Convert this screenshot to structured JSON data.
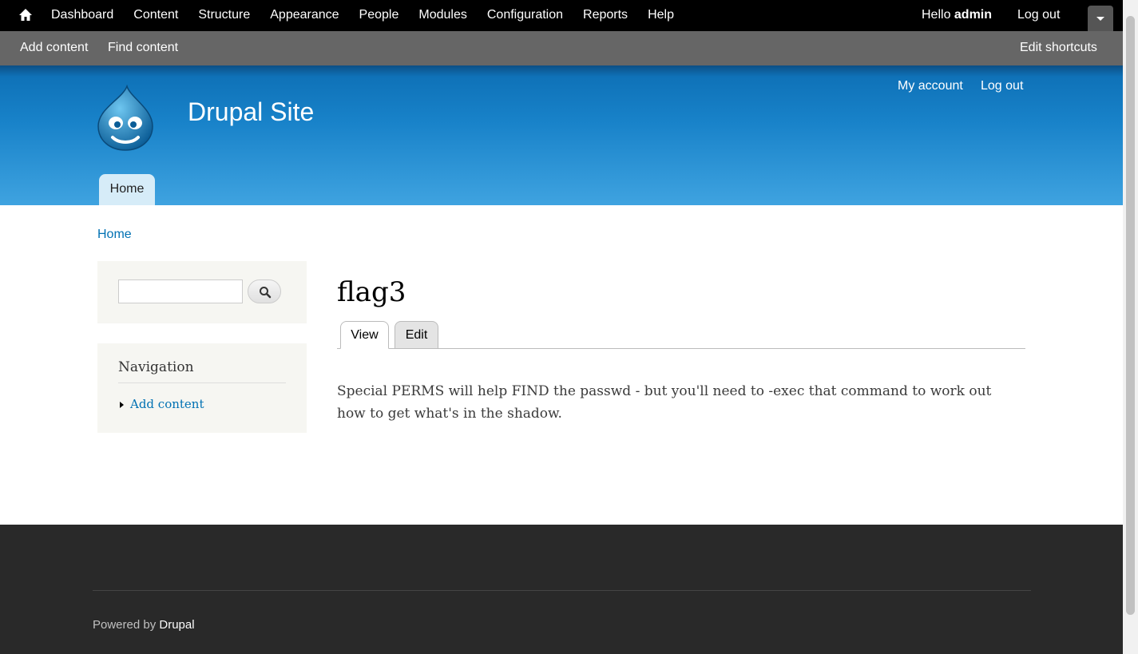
{
  "toolbar": {
    "menu": [
      "Dashboard",
      "Content",
      "Structure",
      "Appearance",
      "People",
      "Modules",
      "Configuration",
      "Reports",
      "Help"
    ],
    "hello_prefix": "Hello ",
    "user": "admin",
    "logout": "Log out"
  },
  "shortcuts": {
    "add_content": "Add content",
    "find_content": "Find content",
    "edit_shortcuts": "Edit shortcuts"
  },
  "header": {
    "site_name": "Drupal Site",
    "my_account": "My account",
    "logout": "Log out",
    "home_tab": "Home"
  },
  "breadcrumb": "Home",
  "search": {
    "value": ""
  },
  "navigation": {
    "title": "Navigation",
    "items": [
      "Add content"
    ]
  },
  "page": {
    "title": "flag3",
    "tabs": [
      "View",
      "Edit"
    ],
    "body": "Special PERMS will help FIND the passwd - but you'll need to -exec that command to work out how to get what's in the shadow."
  },
  "footer": {
    "powered_prefix": "Powered by ",
    "powered_link": "Drupal"
  },
  "colors": {
    "toolbar": "#000000",
    "shortcuts": "#666666",
    "header_blue": "#1882c9",
    "link": "#0071b3",
    "footer": "#292929"
  }
}
